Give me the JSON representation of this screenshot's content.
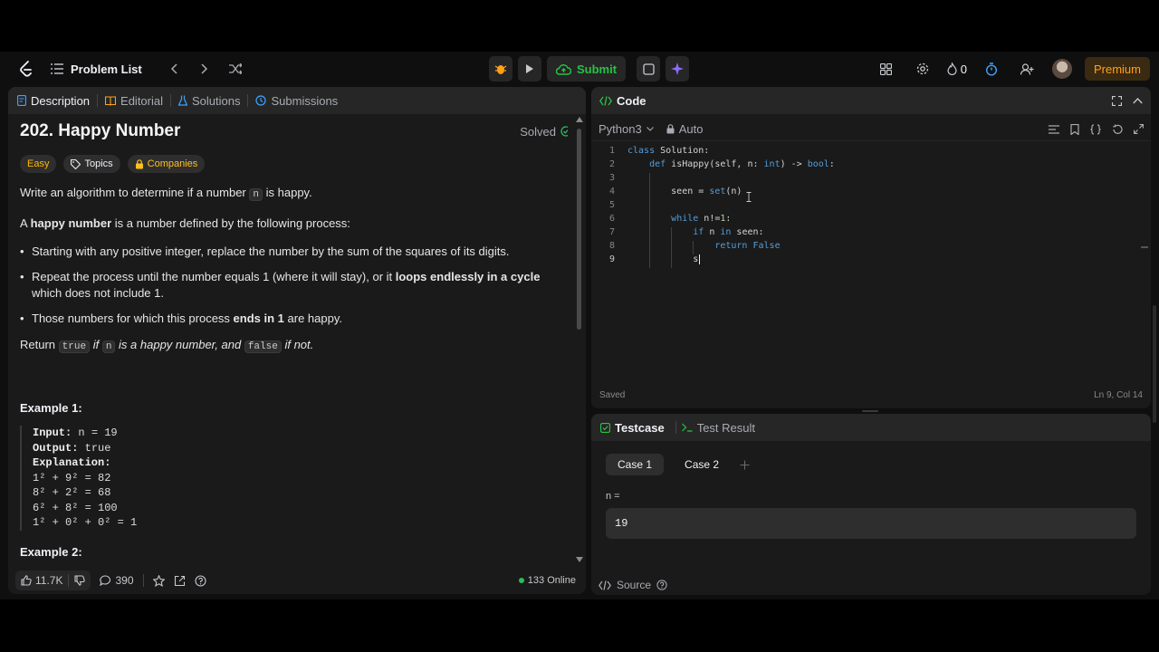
{
  "navbar": {
    "problem_list": "Problem List",
    "submit": "Submit",
    "streak_count": "0",
    "premium": "Premium"
  },
  "left": {
    "tabs": [
      "Description",
      "Editorial",
      "Solutions",
      "Submissions"
    ],
    "title": "202. Happy Number",
    "solved": "Solved",
    "tags": [
      "Easy",
      "Topics",
      "Companies"
    ],
    "p1_a": "Write an algorithm to determine if a number",
    "p1_code": "n",
    "p1_b": "is happy.",
    "p2_a": "A ",
    "p2_bold": "happy number",
    "p2_b": " is a number defined by the following process:",
    "bullets": [
      {
        "a": "Starting with any positive integer, replace the number by the sum of the squares of its digits.",
        "bold": "",
        "b": ""
      },
      {
        "a": "Repeat the process until the number equals 1 (where it will stay), or it ",
        "bold": "loops endlessly in a cycle",
        "b": " which does not include 1."
      },
      {
        "a": "Those numbers for which this process ",
        "bold": "ends in 1",
        "b": " are happy."
      }
    ],
    "ret_a": "Return",
    "ret_true": "true",
    "ret_if": "if",
    "ret_n": "n",
    "ret_mid": "is a happy number, and",
    "ret_false": "false",
    "ret_end": "if not.",
    "example1_title": "Example 1:",
    "example1": {
      "input_label": "Input:",
      "input": "n = 19",
      "output_label": "Output:",
      "output": "true",
      "explanation_label": "Explanation:",
      "lines": [
        "1² + 9² = 82",
        "8² + 2² = 68",
        "6² + 8² = 100",
        "1² + 0² + 0² = 1"
      ]
    },
    "example2_title": "Example 2:",
    "likes": "11.7K",
    "comments": "390",
    "online": "133 Online"
  },
  "code": {
    "title": "Code",
    "language": "Python3",
    "auto": "Auto",
    "lines": [
      "1",
      "2",
      "3",
      "4",
      "5",
      "6",
      "7",
      "8",
      "9"
    ],
    "status_saved": "Saved",
    "status_pos": "Ln 9, Col 14"
  },
  "testcase": {
    "tab1": "Testcase",
    "tab2": "Test Result",
    "case1": "Case 1",
    "case2": "Case 2",
    "var_label": "n =",
    "var_value": "19",
    "source": "Source"
  }
}
